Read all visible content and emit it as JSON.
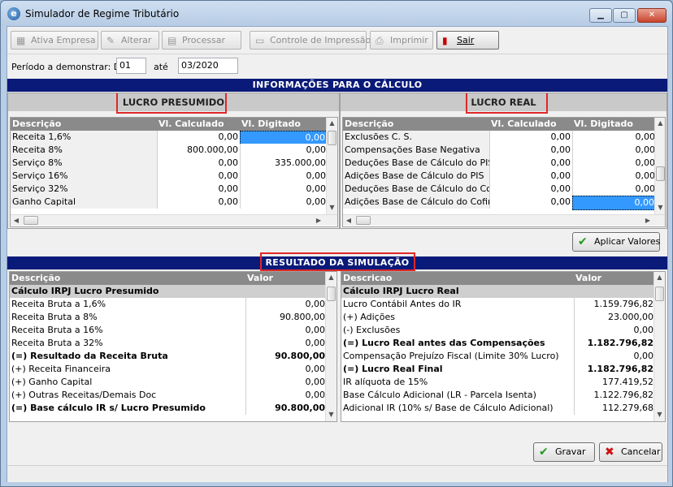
{
  "window": {
    "title": "Simulador de Regime Tributário"
  },
  "toolbar": {
    "ativa_empresa": "Ativa Empresa",
    "alterar": "Alterar",
    "processar": "Processar",
    "controle_impressao": "Controle de Impressão",
    "imprimir": "Imprimir",
    "sair": "Sair"
  },
  "periodo": {
    "label": "Período a demonstrar: De",
    "de": "01",
    "ate_label": "até",
    "ate": "03/2020"
  },
  "info_banner": "INFORMAÇÕES PARA O CÁLCULO",
  "presumido": {
    "title": "LUCRO PRESUMIDO",
    "headers": [
      "Descrição",
      "Vl. Calculado",
      "Vl. Digitado"
    ],
    "rows": [
      [
        "Receita 1,6%",
        "0,00",
        "0,00"
      ],
      [
        "Receita 8%",
        "800.000,00",
        "0,00"
      ],
      [
        "Serviço 8%",
        "0,00",
        "335.000,00"
      ],
      [
        "Serviço 16%",
        "0,00",
        "0,00"
      ],
      [
        "Serviço 32%",
        "0,00",
        "0,00"
      ],
      [
        "Ganho Capital",
        "0,00",
        "0,00"
      ]
    ]
  },
  "real": {
    "title": "LUCRO REAL",
    "headers": [
      "Descrição",
      "Vl. Calculado",
      "Vl. Digitado"
    ],
    "rows": [
      [
        "Exclusões C. S.",
        "0,00",
        "0,00"
      ],
      [
        "Compensações Base Negativa",
        "0,00",
        "0,00"
      ],
      [
        "Deduções Base de Cálculo do PIS",
        "0,00",
        "0,00"
      ],
      [
        "Adições Base de Cálculo do PIS",
        "0,00",
        "0,00"
      ],
      [
        "Deduções Base de Cálculo do Cofins",
        "0,00",
        "0,00"
      ],
      [
        "Adições Base de Cálculo do Cofins",
        "0,00",
        "0,00"
      ]
    ]
  },
  "aplicar_valores": "Aplicar Valores",
  "result_banner": "RESULTADO DA SIMULAÇÃO",
  "res_presumido": {
    "headers": [
      "Descrição",
      "Valor"
    ],
    "group": "Cálculo IRPJ Lucro Presumido",
    "rows": [
      [
        "Receita Bruta a 1,6%",
        "0,00"
      ],
      [
        "Receita Bruta a 8%",
        "90.800,00"
      ],
      [
        "Receita Bruta a 16%",
        "0,00"
      ],
      [
        "Receita Bruta a 32%",
        "0,00"
      ],
      [
        "(=) Resultado da Receita Bruta",
        "90.800,00"
      ],
      [
        "(+) Receita Financeira",
        "0,00"
      ],
      [
        "(+) Ganho Capital",
        "0,00"
      ],
      [
        "(+) Outras Receitas/Demais Doc",
        "0,00"
      ],
      [
        "(=) Base cálculo IR s/ Lucro Presumido",
        "90.800,00"
      ]
    ]
  },
  "res_real": {
    "headers": [
      "Descricao",
      "Valor"
    ],
    "group": "Cálculo IRPJ Lucro Real",
    "rows": [
      [
        "Lucro Contábil Antes do IR",
        "1.159.796,82"
      ],
      [
        "(+) Adições",
        "23.000,00"
      ],
      [
        "(-) Exclusões",
        "0,00"
      ],
      [
        "(=) Lucro Real antes das Compensações",
        "1.182.796,82"
      ],
      [
        "Compensação Prejuízo Fiscal (Limite 30% Lucro)",
        "0,00"
      ],
      [
        "(=) Lucro Real Final",
        "1.182.796,82"
      ],
      [
        "IR alíquota de 15%",
        "177.419,52"
      ],
      [
        "Base Cálculo Adicional (LR - Parcela Isenta)",
        "1.122.796,82"
      ],
      [
        "Adicional IR (10% s/ Base de Cálculo Adicional)",
        "112.279,68"
      ]
    ]
  },
  "gravar": "Gravar",
  "cancelar": "Cancelar",
  "colors": {
    "banner": "#0a1a78",
    "highlight": "#e02828",
    "selection": "#3399ff"
  }
}
